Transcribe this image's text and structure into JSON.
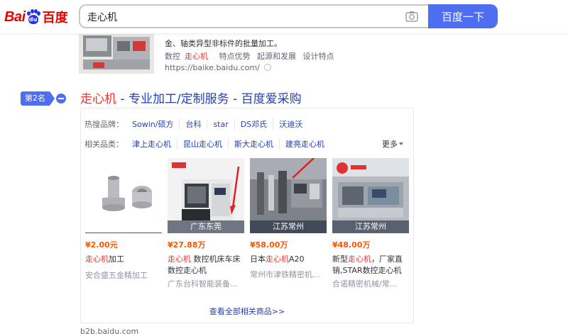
{
  "header": {
    "logo_latin": "Bai",
    "logo_du": "du",
    "logo_cn": "百度",
    "search_value": "走心机",
    "search_button": "百度一下",
    "camera_icon": "camera-icon"
  },
  "prev_result": {
    "snippet_line": "金、轴类异型非标件的批量加工。",
    "links": [
      {
        "pre": "数控",
        "kw": "走心机"
      },
      {
        "pre": "特点优势",
        "kw": ""
      },
      {
        "pre": "起源和发展",
        "kw": ""
      },
      {
        "pre": "设计特点",
        "kw": ""
      }
    ],
    "url": "https://baike.baidu.com/"
  },
  "result": {
    "rank": "第2名",
    "title_kw": "走心机",
    "title_rest": " - 专业加工/定制服务 - 百度爱采购",
    "hot_brands_label": "热搜品牌：",
    "hot_brands": [
      "Sowin/硕方",
      "台科",
      "star",
      "DS邓氏",
      "沃迪沃"
    ],
    "related_label": "相关品类：",
    "related": [
      "津上走心机",
      "昆山走心机",
      "斯大走心机",
      "建亮走心机"
    ],
    "more": "更多",
    "view_all": "查看全部相关商品>>",
    "products": [
      {
        "location": "",
        "price": "¥2.00元",
        "name_kw": "走心机",
        "name_rest": "加工",
        "shop": "安合盛五金精加工"
      },
      {
        "location": "广东东莞",
        "price": "¥27.88万",
        "name_kw": "走心机",
        "name_rest": " 数控机床车床 数控走心机",
        "shop": "广东台科智能装备..."
      },
      {
        "location": "江苏常州",
        "price": "¥58.00万",
        "name_kw": "走心机",
        "name_pre": "日本",
        "name_rest": "A20",
        "shop": "常州市津铁精密机..."
      },
      {
        "location": "江苏常州",
        "price": "¥48.00万",
        "name_kw": "走心机",
        "name_pre": "新型",
        "name_rest": "，厂家直销,STAR数控走心机",
        "shop": "合诺精密机械/常..."
      }
    ]
  },
  "bottom_url": "b2b.baidu.com"
}
